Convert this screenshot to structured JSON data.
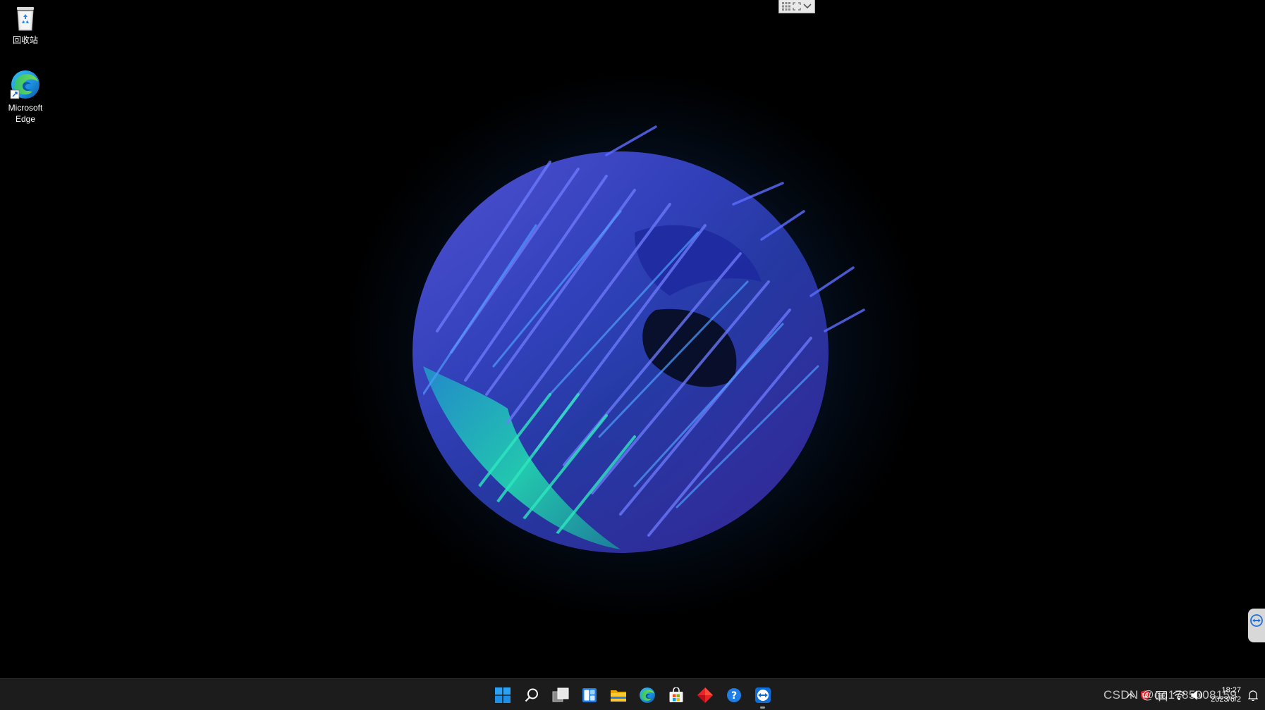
{
  "desktop": {
    "icons": [
      {
        "label": "回收站",
        "icon": "recycle-bin-icon"
      },
      {
        "label": "Microsoft\nEdge",
        "icon": "edge-icon"
      }
    ]
  },
  "remote_toolbar": {
    "buttons": [
      "grid-icon",
      "fullscreen-icon",
      "chevron-down-icon"
    ]
  },
  "taskbar": {
    "apps": [
      {
        "name": "Start",
        "icon": "windows-start-icon"
      },
      {
        "name": "Search",
        "icon": "search-icon"
      },
      {
        "name": "Task View",
        "icon": "task-view-icon"
      },
      {
        "name": "Widgets",
        "icon": "widgets-icon"
      },
      {
        "name": "File Explorer",
        "icon": "folder-icon"
      },
      {
        "name": "Microsoft Edge",
        "icon": "edge-icon"
      },
      {
        "name": "Microsoft Store",
        "icon": "store-icon"
      },
      {
        "name": "App",
        "icon": "red-diamond-icon"
      },
      {
        "name": "Help",
        "icon": "help-icon"
      },
      {
        "name": "TeamViewer",
        "icon": "teamviewer-icon"
      }
    ],
    "tray": {
      "clock_time": "18:27",
      "clock_date": "2023/6/2"
    }
  },
  "watermark": "CSDN @qq1785008159",
  "colors": {
    "accent_blue": "#0078d4",
    "wallpaper_blue": "#3d4fd8",
    "wallpaper_teal": "#22e0b0",
    "taskbar_bg": "#1c1c1c"
  }
}
